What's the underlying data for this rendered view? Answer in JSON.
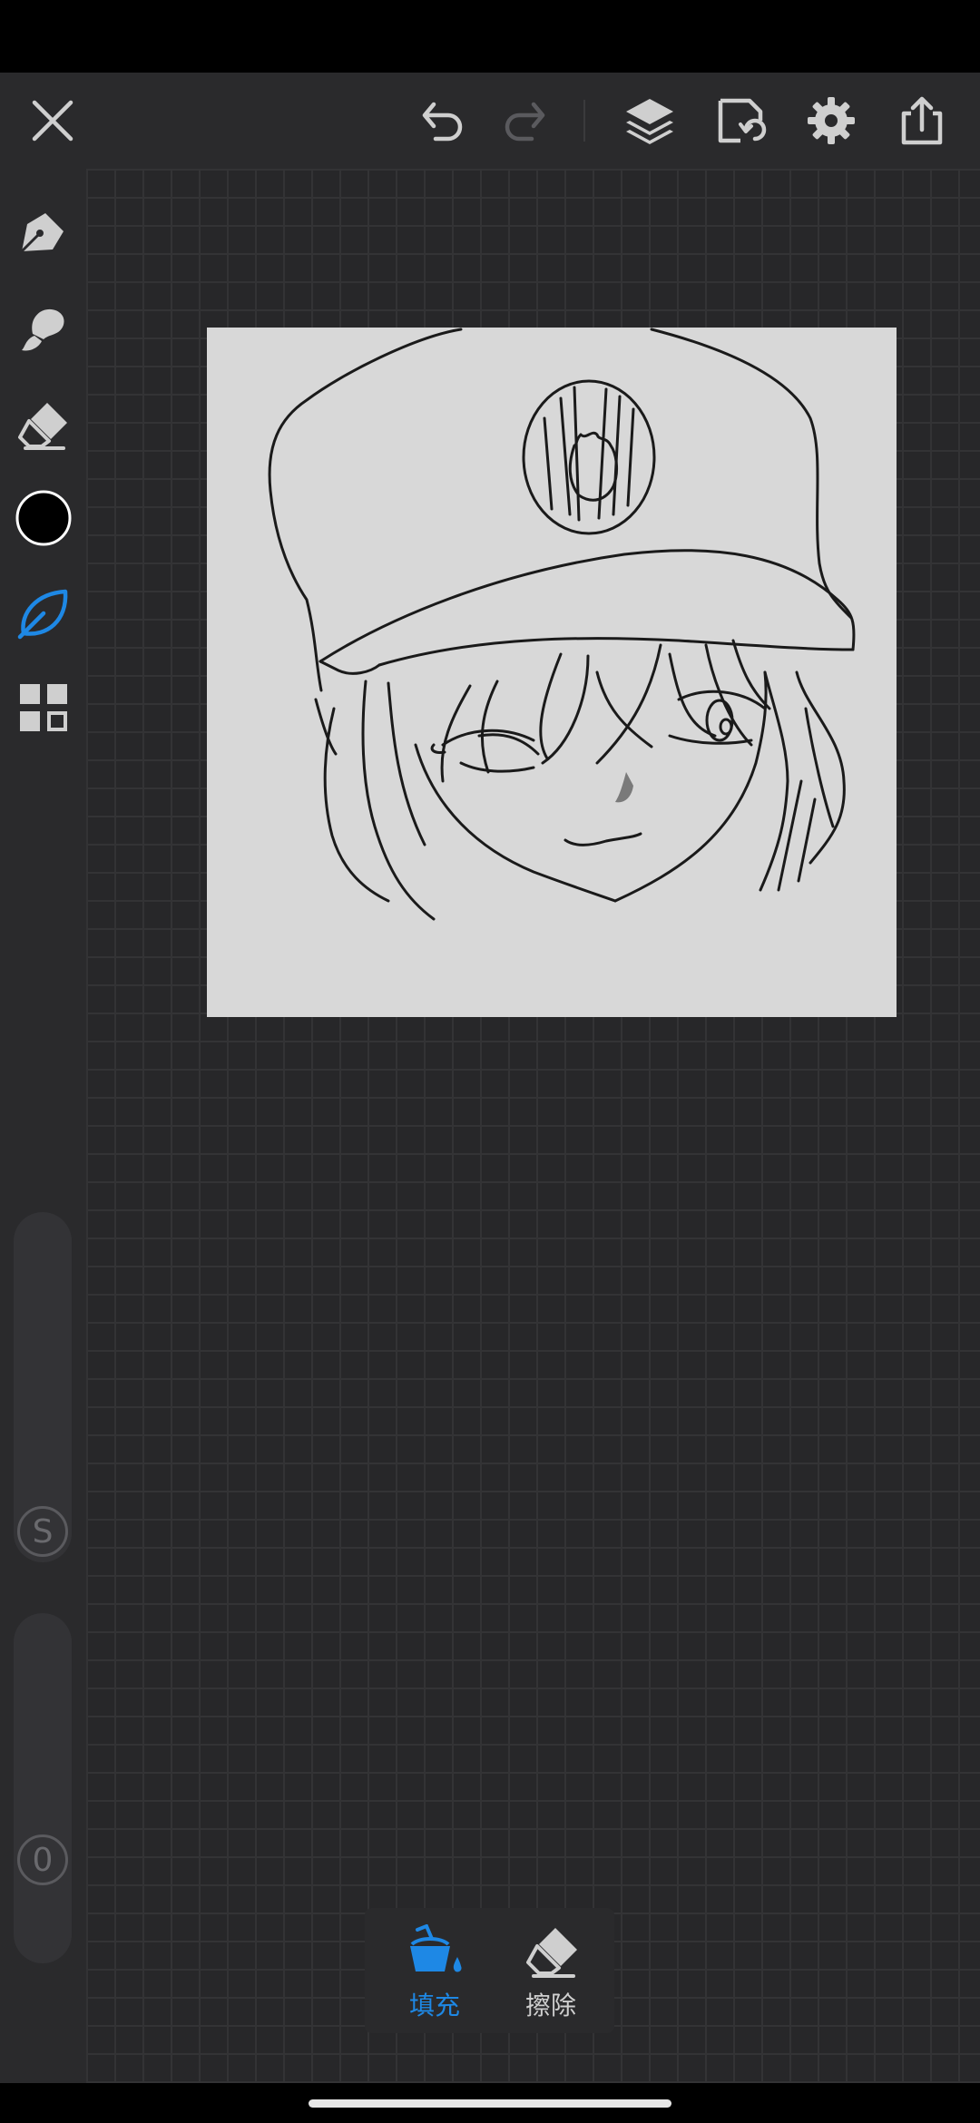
{
  "colors": {
    "accent": "#1e88e5",
    "toolbar_bg": "#2a2a2c",
    "canvas_bg": "#d8d8d8",
    "current_color": "#000000",
    "icon": "#cfcfcf",
    "icon_disabled": "#5a5a5e"
  },
  "top_bar": {
    "icons": [
      "close-icon",
      "undo-icon",
      "redo-icon",
      "layers-icon",
      "import-icon",
      "settings-icon",
      "share-icon"
    ]
  },
  "left_toolbar": {
    "icons": [
      "pen-icon",
      "brush-icon",
      "eraser-icon",
      "color-swatch",
      "leaf-icon",
      "grid-icon"
    ],
    "selected_tool": "leaf-icon",
    "size_slider_label": "S",
    "opacity_slider_label": "0"
  },
  "fill_panel": {
    "fill_label": "填充",
    "erase_label": "擦除",
    "selected": "fill"
  }
}
